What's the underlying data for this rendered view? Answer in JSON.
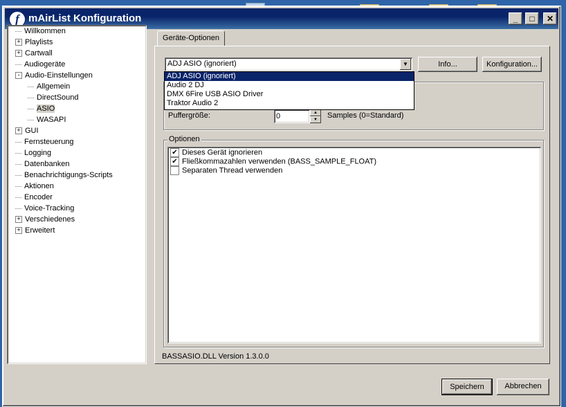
{
  "window": {
    "title": "mAirList Konfiguration"
  },
  "tree": {
    "items": [
      {
        "label": "Willkommen",
        "expander": "none",
        "level": 0
      },
      {
        "label": "Playlists",
        "expander": "+",
        "level": 0
      },
      {
        "label": "Cartwall",
        "expander": "+",
        "level": 0
      },
      {
        "label": "Audiogeräte",
        "expander": "none",
        "level": 0
      },
      {
        "label": "Audio-Einstellungen",
        "expander": "-",
        "level": 0
      },
      {
        "label": "Allgemein",
        "expander": "none",
        "level": 1
      },
      {
        "label": "DirectSound",
        "expander": "none",
        "level": 1
      },
      {
        "label": "ASIO",
        "expander": "none",
        "level": 1,
        "selected": true
      },
      {
        "label": "WASAPI",
        "expander": "none",
        "level": 1
      },
      {
        "label": "GUI",
        "expander": "+",
        "level": 0
      },
      {
        "label": "Fernsteuerung",
        "expander": "none",
        "level": 0
      },
      {
        "label": "Logging",
        "expander": "none",
        "level": 0
      },
      {
        "label": "Datenbanken",
        "expander": "none",
        "level": 0
      },
      {
        "label": "Benachrichtigungs-Scripts",
        "expander": "none",
        "level": 0
      },
      {
        "label": "Aktionen",
        "expander": "none",
        "level": 0
      },
      {
        "label": "Encoder",
        "expander": "none",
        "level": 0
      },
      {
        "label": "Voice-Tracking",
        "expander": "none",
        "level": 0
      },
      {
        "label": "Verschiedenes",
        "expander": "+",
        "level": 0
      },
      {
        "label": "Erweitert",
        "expander": "+",
        "level": 0
      }
    ]
  },
  "tab": {
    "label": "Geräte-Optionen"
  },
  "device": {
    "selected": "ADJ ASIO (ignoriert)",
    "options": [
      "ADJ ASIO (ignoriert)",
      "Audio 2 DJ",
      "DMX 6Fire USB ASIO Driver",
      "Traktor Audio 2"
    ]
  },
  "buttons": {
    "info": "Info...",
    "config": "Konfiguration...",
    "save": "Speichern",
    "cancel": "Abbrechen"
  },
  "buffer": {
    "label": "Puffergröße:",
    "value": "0",
    "unit": "Samples (0=Standard)"
  },
  "options": {
    "legend": "Optionen",
    "items": [
      {
        "label": "Dieses Gerät ignorieren",
        "checked": true
      },
      {
        "label": "Fließkommazahlen verwenden (BASS_SAMPLE_FLOAT)",
        "checked": true
      },
      {
        "label": "Separaten Thread verwenden",
        "checked": false
      }
    ]
  },
  "version": "BASSASIO.DLL Version 1.3.0.0"
}
